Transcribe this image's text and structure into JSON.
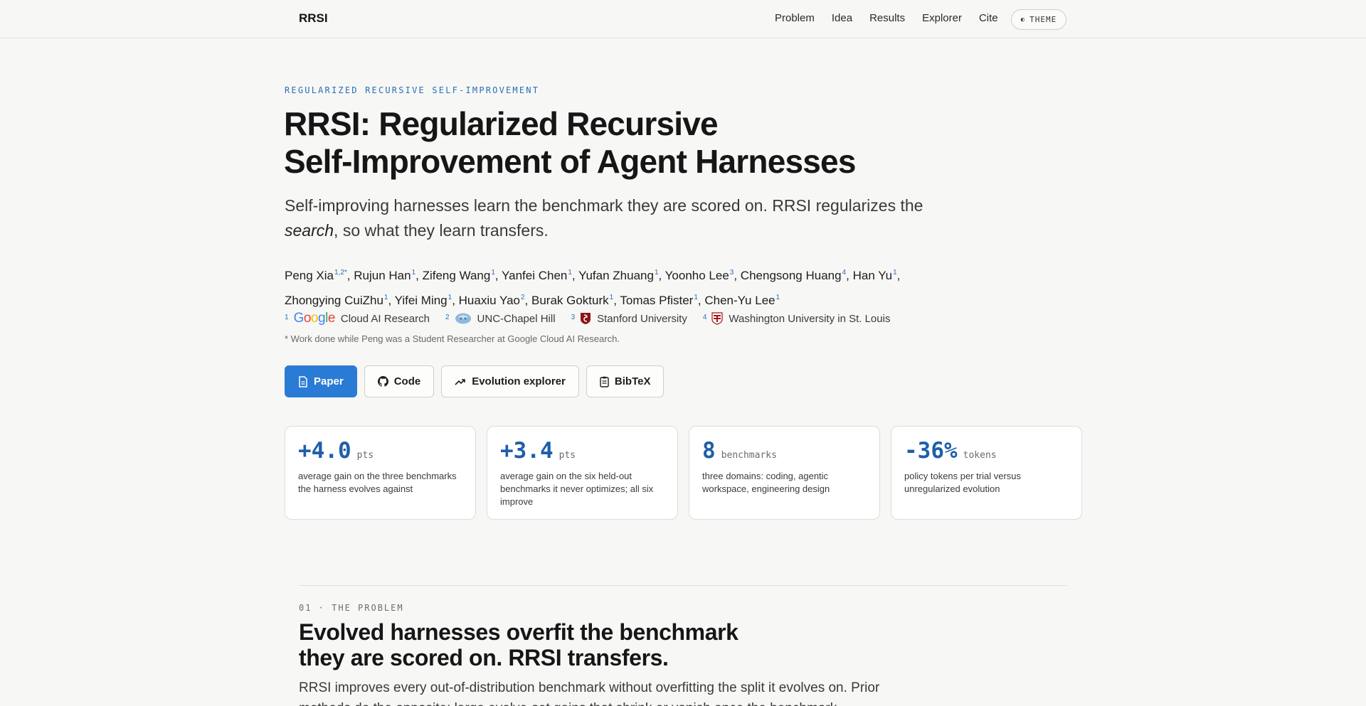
{
  "nav": {
    "brand": "RRSI",
    "links": [
      "Problem",
      "Idea",
      "Results",
      "Explorer",
      "Cite"
    ],
    "theme_label": "THEME"
  },
  "hero": {
    "kicker": "REGULARIZED RECURSIVE SELF-IMPROVEMENT",
    "title_line1": "RRSI: Regularized Recursive",
    "title_line2": "Self-Improvement of Agent Harnesses",
    "subtitle_pre": "Self-improving harnesses learn the benchmark they are scored on. RRSI regularizes the ",
    "subtitle_em": "search",
    "subtitle_post": ", so what they learn transfers.",
    "authors": [
      {
        "name": "Peng Xia",
        "sup": "1,2*"
      },
      {
        "name": "Rujun Han",
        "sup": "1"
      },
      {
        "name": "Zifeng Wang",
        "sup": "1"
      },
      {
        "name": "Yanfei Chen",
        "sup": "1"
      },
      {
        "name": "Yufan Zhuang",
        "sup": "1"
      },
      {
        "name": "Yoonho Lee",
        "sup": "3"
      },
      {
        "name": "Chengsong Huang",
        "sup": "4"
      },
      {
        "name": "Han Yu",
        "sup": "1"
      },
      {
        "name": "Zhongying CuiZhu",
        "sup": "1"
      },
      {
        "name": "Yifei Ming",
        "sup": "1"
      },
      {
        "name": "Huaxiu Yao",
        "sup": "2"
      },
      {
        "name": "Burak Gokturk",
        "sup": "1"
      },
      {
        "name": "Tomas Pfister",
        "sup": "1"
      },
      {
        "name": "Chen-Yu Lee",
        "sup": "1"
      }
    ],
    "affiliations": [
      {
        "num": "1",
        "logo": "google-logo",
        "logo_text": "Google",
        "name": "Cloud AI Research"
      },
      {
        "num": "2",
        "logo": "unc-logo",
        "name": "UNC-Chapel Hill"
      },
      {
        "num": "3",
        "logo": "stanford-logo",
        "name": "Stanford University"
      },
      {
        "num": "4",
        "logo": "washu-logo",
        "name": "Washington University in St. Louis"
      }
    ],
    "note": "* Work done while Peng was a Student Researcher at Google Cloud AI Research.",
    "buttons": {
      "paper": "Paper",
      "code": "Code",
      "explorer": "Evolution explorer",
      "bibtex": "BibTeX"
    }
  },
  "stats": [
    {
      "value": "+4.0",
      "unit": "pts",
      "desc": "average gain on the three benchmarks the harness evolves against"
    },
    {
      "value": "+3.4",
      "unit": "pts",
      "desc": "average gain on the six held-out benchmarks it never optimizes; all six improve"
    },
    {
      "value": "8",
      "unit": "benchmarks",
      "desc": "three domains: coding, agentic workspace, engineering design"
    },
    {
      "value": "-36%",
      "unit": "tokens",
      "desc": "policy tokens per trial versus unregularized evolution"
    }
  ],
  "section": {
    "kicker": "01 · THE PROBLEM",
    "title_line1": "Evolved harnesses overfit the benchmark",
    "title_line2": "they are scored on. RRSI transfers.",
    "body": "RRSI improves every out-of-distribution benchmark without overfitting the split it evolves on. Prior methods do the opposite: large evolve-set gains that shrink or vanish once the benchmark"
  },
  "colors": {
    "accent": "#2a7bd6",
    "stat_value": "#1e5fa8",
    "kicker": "#2a6fb4",
    "background": "#f7f7f6"
  }
}
